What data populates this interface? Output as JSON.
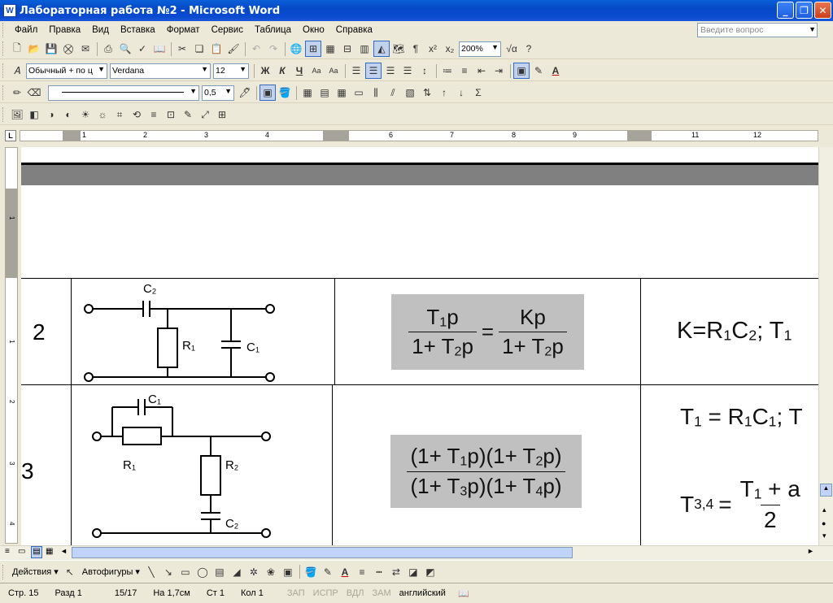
{
  "window": {
    "title": "Лабораторная работа №2 - Microsoft Word"
  },
  "menu": {
    "items": [
      "Файл",
      "Правка",
      "Вид",
      "Вставка",
      "Формат",
      "Сервис",
      "Таблица",
      "Окно",
      "Справка"
    ],
    "ask_placeholder": "Введите вопрос"
  },
  "toolbar": {
    "zoom": "200%",
    "style": "Обычный + по ц",
    "font": "Verdana",
    "size": "12",
    "line_weight": "0,5"
  },
  "document": {
    "row2": {
      "num": "2",
      "labels": {
        "c2": "C",
        "c2_sub": "2",
        "r1": "R",
        "r1_sub": "1",
        "c1": "C",
        "c1_sub": "1"
      },
      "formula_left_num": "T",
      "formula_left_num_sub": "1",
      "formula_left_num_p": "p",
      "formula_left_den_a": "1+ T",
      "formula_left_den_sub": "2",
      "formula_left_den_b": "p",
      "eq": "=",
      "formula_right_num": "Kp",
      "formula_right_den_a": "1+ T",
      "formula_right_den_sub": "2",
      "formula_right_den_b": "p",
      "params": "K=R",
      "params_sub1": "1",
      "params_mid": "C",
      "params_sub2": "2",
      "params_end": "; T",
      "params_sub3": "1"
    },
    "row3": {
      "num": "3",
      "labels": {
        "c1": "C",
        "c1_sub": "1",
        "r1": "R",
        "r1_sub": "1",
        "r2": "R",
        "r2_sub": "2",
        "c2": "C",
        "c2_sub": "2"
      },
      "num_a": "(1+ T",
      "num_sub1": "1",
      "num_b": "p)(1+ T",
      "num_sub2": "2",
      "num_c": "p)",
      "den_a": "(1+ T",
      "den_sub1": "3",
      "den_b": "p)(1+ T",
      "den_sub2": "4",
      "den_c": "p)",
      "p1_a": "T",
      "p1_sub": "1",
      "p1_b": " = R",
      "p1_sub2": "1",
      "p1_c": "C",
      "p1_sub3": "1",
      "p1_d": "; T",
      "p2_a": "T",
      "p2_sub": "3,4",
      "p2_eq": " =",
      "p2_num_a": "T",
      "p2_num_sub": "1",
      "p2_num_b": " + a",
      "p2_den": "2"
    }
  },
  "drawing": {
    "actions": "Действия",
    "autoshapes": "Автофигуры"
  },
  "status": {
    "page": "Стр. 15",
    "section": "Разд 1",
    "pages": "15/17",
    "at": "На 1,7см",
    "line": "Ст 1",
    "col": "Кол 1",
    "rec": "ЗАП",
    "trk": "ИСПР",
    "ext": "ВДЛ",
    "ovr": "ЗАМ",
    "lang": "английский"
  }
}
